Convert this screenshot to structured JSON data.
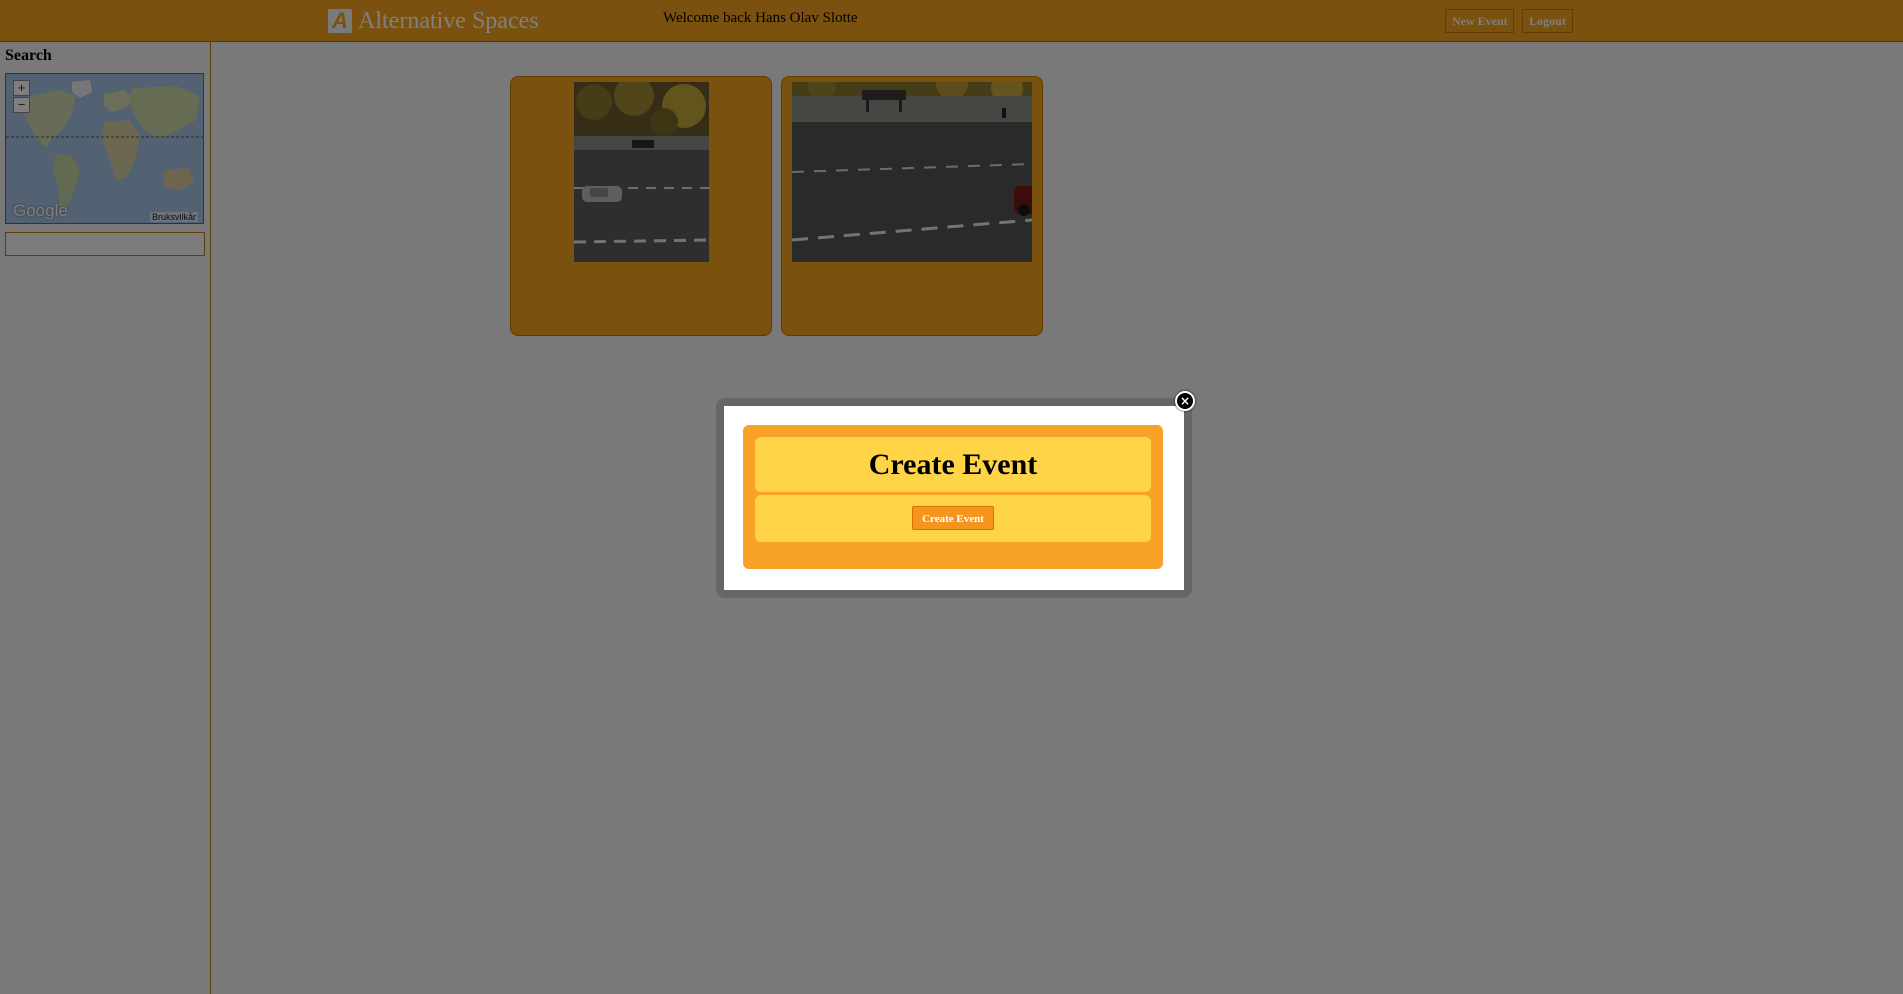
{
  "header": {
    "logo_letter": "A",
    "app_title": "Alternative Spaces",
    "welcome_text": "Welcome back Hans Olav Slotte",
    "new_event_label": "New Event",
    "logout_label": "Logout"
  },
  "sidebar": {
    "search_label": "Search",
    "map": {
      "zoom_in": "+",
      "zoom_out": "−",
      "provider": "Google",
      "terms": "Bruksvilkår"
    },
    "search_input_value": ""
  },
  "cards": [
    {
      "image": "road-photo-portrait"
    },
    {
      "image": "road-photo-landscape"
    }
  ],
  "modal": {
    "title": "Create Event",
    "button_label": "Create Event",
    "close_icon": "×"
  },
  "colors": {
    "accent": "#f7a21f",
    "modal_panel": "#f9a22a",
    "modal_inner": "#ffd547",
    "overlay": "rgba(0,0,0,0.5)"
  }
}
